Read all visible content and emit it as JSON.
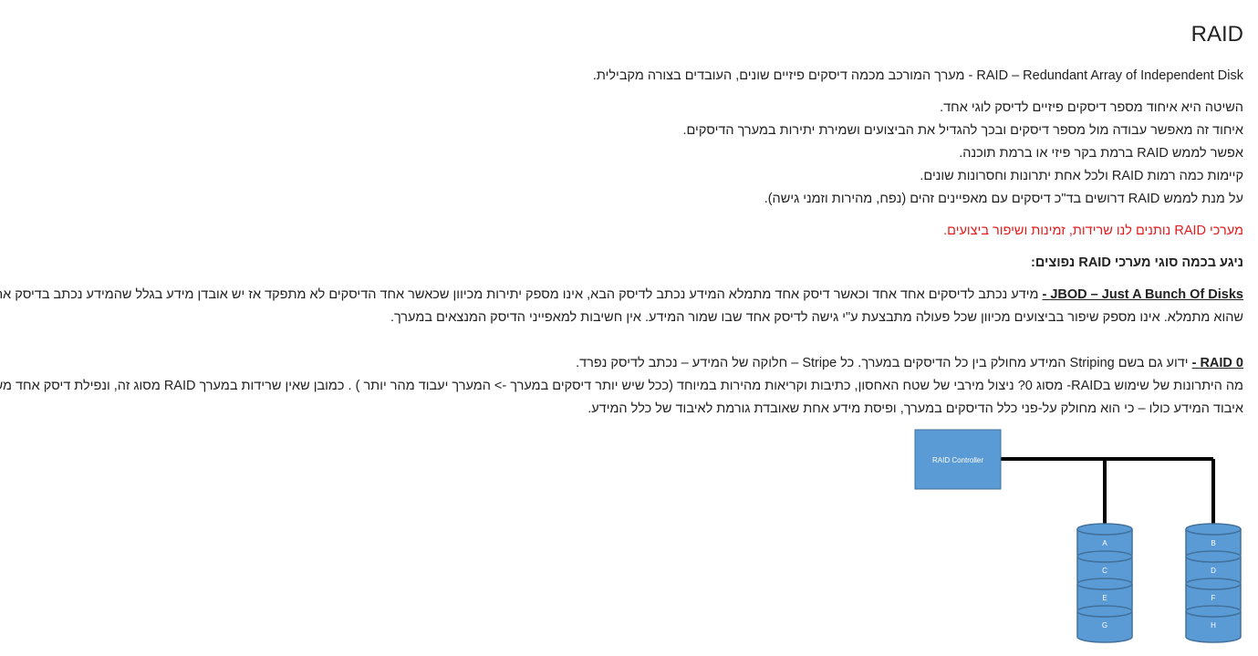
{
  "title": "RAID",
  "intro": {
    "prefix": "RAID – Redundant Array of Independent Disk - ",
    "rest": "מערך המורכב מכמה דיסקים פיזיים שונים, העובדים בצורה מקבילית."
  },
  "paragraphs": [
    "השיטה היא איחוד מספר דיסקים פיזיים לדיסק לוגי אחד.",
    "איחוד זה מאפשר עבודה מול מספר דיסקים ובכך להגדיל את הביצועים ושמירת יתירות במערך הדיסקים.",
    "אפשר לממש RAID ברמת בקר פיזי או ברמת תוכנה.",
    "קיימות כמה רמות RAID ולכל אחת יתרונות וחסרונות שונים.",
    "על מנת לממש RAID  דרושים בד\"כ דיסקים עם מאפיינים זהים (נפח, מהירות וזמני גישה)."
  ],
  "highlight": "מערכי RAID נותנים לנו שרידות, זמינות ושיפור ביצועים.",
  "section_heading": "ניגע בכמה סוגי מערכי RAID נפוצים:",
  "jbod": {
    "term": "JBOD – Just A Bunch Of Disks -",
    "line1": " מידע נכתב לדיסקים אחד אחד וכאשר דיסק אחד מתמלא המידע נכתב לדיסק הבא, אינו מספק יתירות מכיוון שכאשר אחד הדיסקים לא מתפקד אז יש אובדן מידע בגלל שהמידע נכתב בדיסק אחד עד",
    "line2": "שהוא מתמלא. אינו מספק שיפור בביצועים מכיוון שכל פעולה מתבצעת ע\"י גישה לדיסק אחד שבו שמור המידע. אין חשיבות למאפייני הדיסק המנצאים במערך."
  },
  "raid0": {
    "term": "RAID 0 -",
    "line1": " ידוע גם בשם Striping המידע מחולק בין כל הדיסקים במערך. כל Stripe – חלוקה של המידע – נכתב לדיסק נפרד.",
    "line2": "מה היתרונות של שימוש בRAID- מסוג 0? ניצול מירבי של שטח האחסון, כתיבות וקריאות מהירות במיוחד (ככל שיש יותר דיסקים במערך -> המערך יעבוד מהר יותר ) . כמובן שאין שרידות במערך RAID מסוג זה, ונפילת דיסק אחד משמעותה",
    "line3": "איבוד המידע כולו – כי הוא מחולק על-פני כלל הדיסקים במערך, ופיסת מידע אחת שאובדת גורמת לאיבוד של כלל המידע."
  },
  "diagram": {
    "controller_label": "RAID Controller",
    "disk1": [
      "A",
      "C",
      "E",
      "G"
    ],
    "disk2": [
      "B",
      "D",
      "F",
      "H"
    ],
    "disk_color": "#5b9bd5",
    "disk_stroke": "#41719c"
  }
}
